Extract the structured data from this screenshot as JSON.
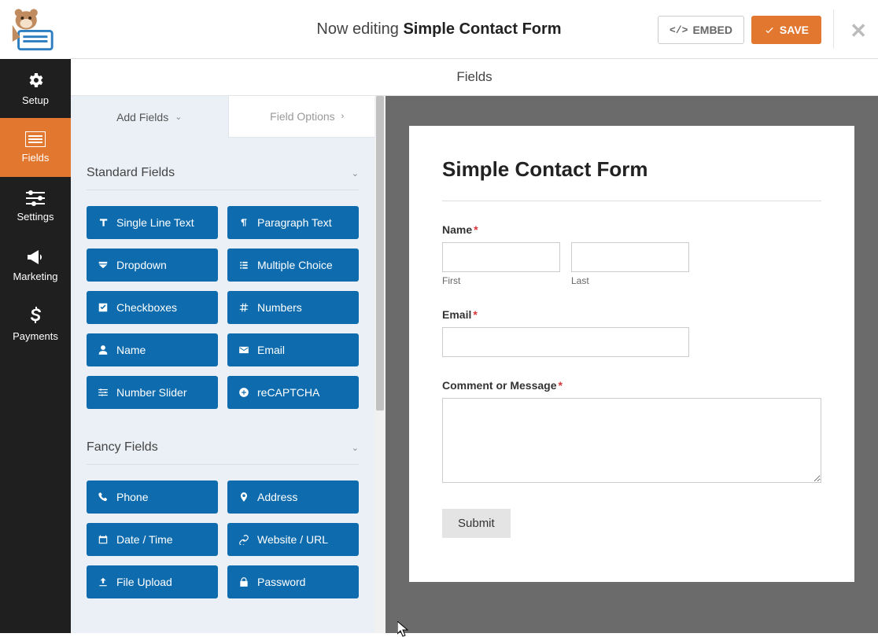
{
  "header": {
    "editing_prefix": "Now editing ",
    "form_name": "Simple Contact Form",
    "embed_label": "EMBED",
    "save_label": "SAVE"
  },
  "sidebar": {
    "items": [
      {
        "label": "Setup"
      },
      {
        "label": "Fields"
      },
      {
        "label": "Settings"
      },
      {
        "label": "Marketing"
      },
      {
        "label": "Payments"
      }
    ]
  },
  "builder": {
    "section_title": "Fields",
    "tabs": {
      "add_fields": "Add Fields",
      "field_options": "Field Options"
    },
    "groups": [
      {
        "title": "Standard Fields",
        "fields": [
          "Single Line Text",
          "Paragraph Text",
          "Dropdown",
          "Multiple Choice",
          "Checkboxes",
          "Numbers",
          "Name",
          "Email",
          "Number Slider",
          "reCAPTCHA"
        ]
      },
      {
        "title": "Fancy Fields",
        "fields": [
          "Phone",
          "Address",
          "Date / Time",
          "Website / URL",
          "File Upload",
          "Password"
        ]
      }
    ]
  },
  "form": {
    "title": "Simple Contact Form",
    "name_label": "Name",
    "first_sub": "First",
    "last_sub": "Last",
    "email_label": "Email",
    "comment_label": "Comment or Message",
    "submit_label": "Submit"
  }
}
